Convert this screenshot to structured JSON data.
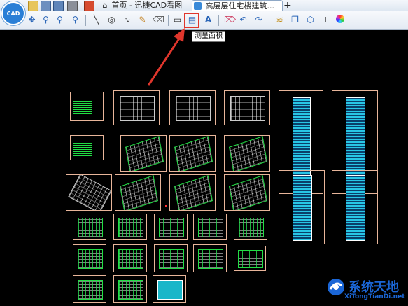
{
  "app": {
    "logo_text": "CAD"
  },
  "tabs": [
    {
      "label": "首页 - 迅捷CAD看图",
      "icon": "home-icon",
      "active": false
    },
    {
      "label": "高层层住宅楼建筑...",
      "icon": "drawing-file-icon",
      "active": true
    }
  ],
  "tabbar": {
    "new_tab_label": "+",
    "quick_access": [
      "open-folder-icon",
      "save-icon",
      "save-as-icon",
      "print-icon",
      "home-flag-icon"
    ]
  },
  "toolbar": {
    "left_tools": [
      "zoom-window-icon",
      "zoom-realtime-icon",
      "zoom-extents-icon",
      "zoom-previous-icon"
    ],
    "draw_tools": [
      "line-icon",
      "circle-icon",
      "polyline-icon",
      "pencil-icon",
      "eraser-tag-icon"
    ],
    "measure_tools": [
      "measure-length-icon",
      "measure-area-icon",
      "text-tool-icon"
    ],
    "right_tools": [
      "eraser-icon",
      "undo-icon",
      "redo-icon",
      "layer-icon",
      "layout-icon",
      "3d-box-icon",
      "dimension-icon",
      "color-wheel-icon"
    ],
    "tooltip": "测量面积",
    "highlight_color": "#e0362c"
  },
  "canvas": {
    "background": "#000000",
    "sheet_border_color": "#e8b59a"
  },
  "watermark": {
    "title": "系统天地",
    "url": "XiTongTianDi.net",
    "color": "#1b66d6"
  }
}
